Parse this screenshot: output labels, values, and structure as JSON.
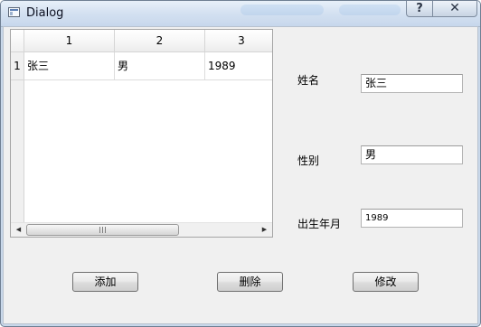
{
  "window": {
    "title": "Dialog",
    "help_button": "?",
    "close_button": "✕"
  },
  "table": {
    "column_headers": [
      "1",
      "2",
      "3"
    ],
    "row_headers": [
      "1"
    ],
    "rows": [
      [
        "张三",
        "男",
        "1989"
      ]
    ],
    "scroll_grip": "III",
    "scroll_left_arrow": "◀",
    "scroll_right_arrow": "▶"
  },
  "form": {
    "name_label": "姓名",
    "name_value": "张三",
    "gender_label": "性别",
    "gender_value": "男",
    "birth_label": "出生年月",
    "birth_value": "1989"
  },
  "buttons": {
    "add": "添加",
    "delete": "删除",
    "modify": "修改"
  },
  "colors": {
    "titlebar": "#d4e1f1",
    "dialog_background": "#f0f0f0",
    "table_background": "#ffffff"
  },
  "icons": {
    "window_icon": "app-window-icon",
    "help": "help-icon",
    "close": "close-icon",
    "scroll_left": "chevron-left-icon",
    "scroll_right": "chevron-right-icon"
  }
}
